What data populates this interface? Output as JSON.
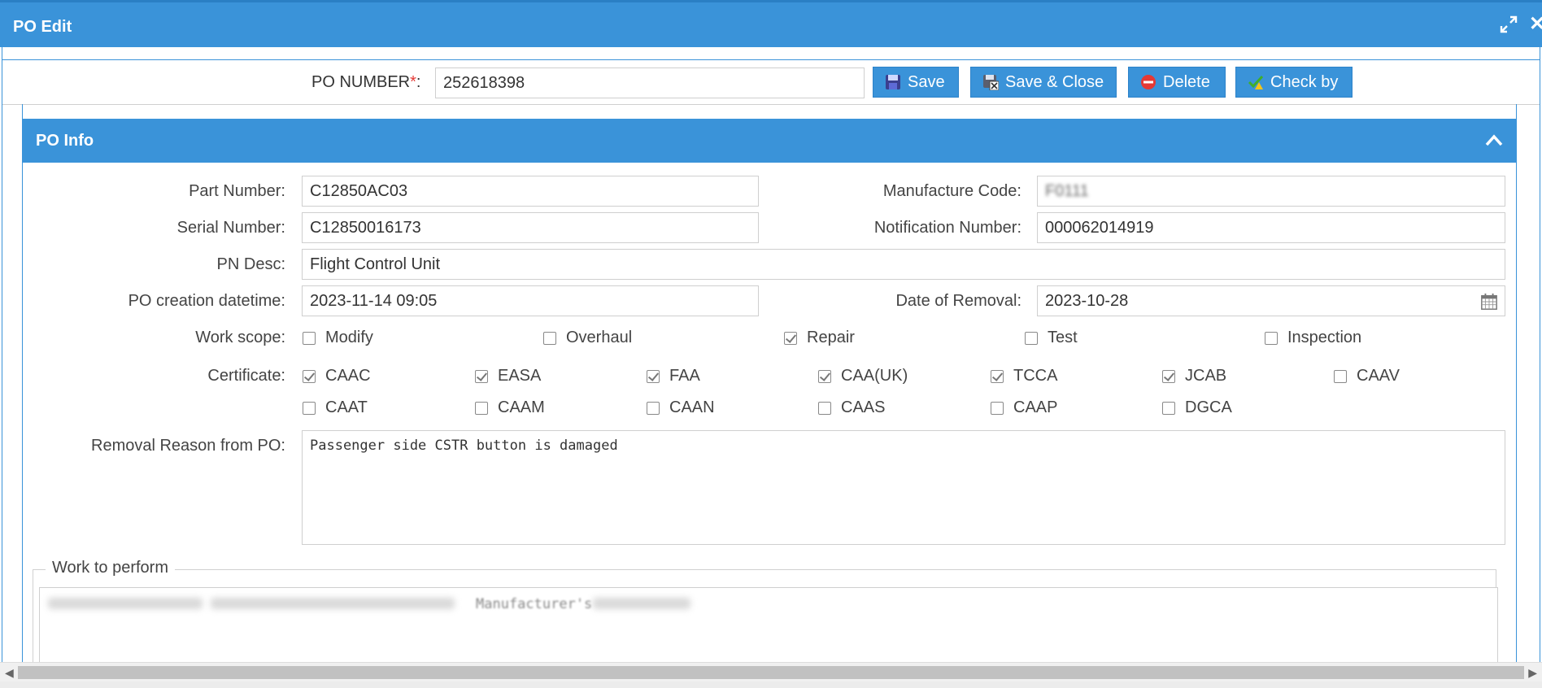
{
  "window": {
    "title": "PO Edit"
  },
  "po": {
    "label": "PO NUMBER",
    "required_mark": "*",
    "colon": ":",
    "value": "252618398"
  },
  "toolbar": {
    "save_label": "Save",
    "save_close_label": "Save & Close",
    "delete_label": "Delete",
    "checkby_label": "Check by"
  },
  "section": {
    "title": "PO Info"
  },
  "fields": {
    "part_number": {
      "label": "Part Number:",
      "value": "C12850AC03"
    },
    "manufacture_code": {
      "label": "Manufacture Code:",
      "value": "F0111"
    },
    "serial_number": {
      "label": "Serial Number:",
      "value": "C12850016173"
    },
    "notification_number": {
      "label": "Notification Number:",
      "value": "000062014919"
    },
    "pn_desc": {
      "label": "PN Desc:",
      "value": "Flight Control Unit"
    },
    "po_creation": {
      "label": "PO creation datetime:",
      "value": "2023-11-14 09:05"
    },
    "date_of_removal": {
      "label": "Date of Removal:",
      "value": "2023-10-28"
    }
  },
  "work_scope": {
    "label": "Work scope:",
    "options": [
      {
        "label": "Modify",
        "checked": false
      },
      {
        "label": "Overhaul",
        "checked": false
      },
      {
        "label": "Repair",
        "checked": true
      },
      {
        "label": "Test",
        "checked": false
      },
      {
        "label": "Inspection",
        "checked": false
      }
    ]
  },
  "certificate": {
    "label": "Certificate:",
    "options": [
      {
        "label": "CAAC",
        "checked": true
      },
      {
        "label": "EASA",
        "checked": true
      },
      {
        "label": "FAA",
        "checked": true
      },
      {
        "label": "CAA(UK)",
        "checked": true
      },
      {
        "label": "TCCA",
        "checked": true
      },
      {
        "label": "JCAB",
        "checked": true
      },
      {
        "label": "CAAV",
        "checked": false
      },
      {
        "label": "CAAT",
        "checked": false
      },
      {
        "label": "CAAM",
        "checked": false
      },
      {
        "label": "CAAN",
        "checked": false
      },
      {
        "label": "CAAS",
        "checked": false
      },
      {
        "label": "CAAP",
        "checked": false
      },
      {
        "label": "DGCA",
        "checked": false
      }
    ]
  },
  "removal_reason": {
    "label": "Removal Reason from PO:",
    "value": "Passenger side CSTR button is damaged"
  },
  "work_to_perform": {
    "legend": "Work to perform",
    "value": "Manufacturer's"
  },
  "colors": {
    "accent": "#3a93d9",
    "delete_icon": "#e53935"
  },
  "icons": {
    "expand": "expand-icon",
    "close": "close-icon",
    "save": "floppy-disk-icon",
    "save_close": "floppy-close-icon",
    "delete": "no-entry-icon",
    "checkby": "check-warning-icon",
    "collapse": "chevron-up-icon",
    "calendar": "calendar-icon"
  }
}
